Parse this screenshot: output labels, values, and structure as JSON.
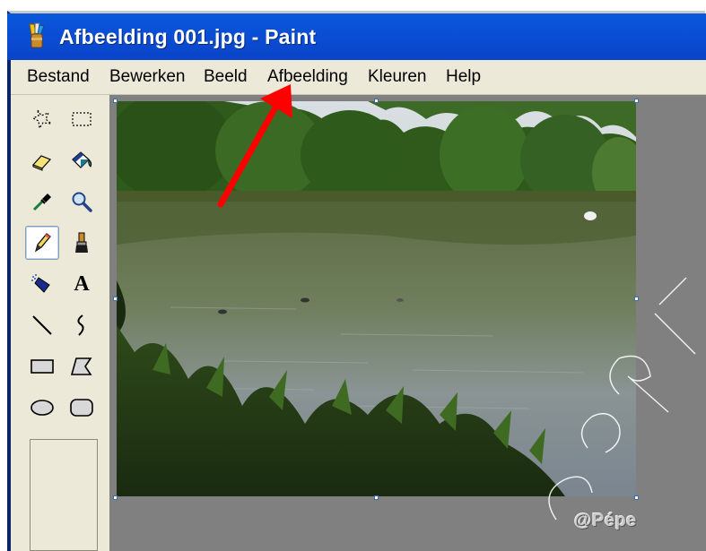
{
  "window": {
    "title": "Afbeelding 001.jpg - Paint",
    "app_icon": "paint-brush-icon"
  },
  "menubar": {
    "items": [
      "Bestand",
      "Bewerken",
      "Beeld",
      "Afbeelding",
      "Kleuren",
      "Help"
    ]
  },
  "toolbox": {
    "tools": [
      {
        "name": "free-form-select-icon"
      },
      {
        "name": "rectangle-select-icon"
      },
      {
        "name": "eraser-icon"
      },
      {
        "name": "fill-bucket-icon"
      },
      {
        "name": "pick-color-icon"
      },
      {
        "name": "magnifier-icon"
      },
      {
        "name": "pencil-icon",
        "active": true
      },
      {
        "name": "brush-icon"
      },
      {
        "name": "airbrush-icon"
      },
      {
        "name": "text-icon",
        "glyph": "A"
      },
      {
        "name": "line-icon"
      },
      {
        "name": "curve-icon"
      },
      {
        "name": "rectangle-icon"
      },
      {
        "name": "polygon-icon"
      },
      {
        "name": "ellipse-icon"
      },
      {
        "name": "rounded-rectangle-icon"
      }
    ]
  },
  "canvas": {
    "image": "photo of a pond with trees and ducks",
    "annotation": "red-arrow pointing to Afbeelding menu"
  },
  "watermark": {
    "credit": "@Pépe",
    "diagonal": "Pépe & Tr"
  },
  "colors": {
    "titlebar": "#0a4fd6",
    "menubar": "#ece9d8",
    "canvas_bg": "#808080",
    "arrow": "#ff0000"
  }
}
